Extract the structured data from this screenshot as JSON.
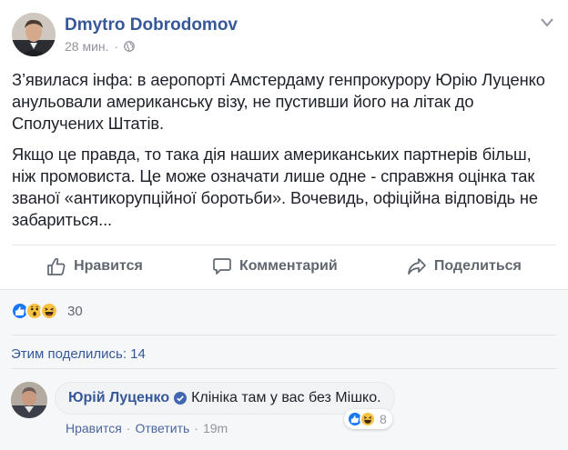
{
  "post": {
    "author": "Dmytro Dobrodomov",
    "time": "28 мин.",
    "paragraphs": [
      "З’явилася інфа: в аеропорті Амстердаму генпрокурору Юрію Луценко анульовали американську візу, не пустивши його на літак до Сполучених Штатів.",
      "Якщо це правда, то така дія наших американських партнерів більш, ніж промовиста. Це може означати лише одне - справжня оцінка так званої «антикорупційної боротьби». Вочевидь, офіційна відповідь не забариться..."
    ]
  },
  "actions": {
    "like_label": "Нравится",
    "comment_label": "Комментарий",
    "share_label": "Поделиться"
  },
  "reactions": {
    "icons": [
      "like-reaction",
      "wow-reaction",
      "haha-reaction"
    ],
    "count": "30"
  },
  "shares": {
    "text": "Этим поделились: 14"
  },
  "comment": {
    "author": "Юрій Луценко",
    "verified": true,
    "text": "Клініка там у вас без Мішко.",
    "like_label": "Нравится",
    "reply_label": "Ответить",
    "time": "19m",
    "reaction_icons": [
      "like-reaction",
      "haha-reaction"
    ],
    "reaction_count": "8"
  },
  "colors": {
    "link_blue": "#365899",
    "like_blue": "#1877f2",
    "reaction_yellow": "#f7c241",
    "muted_gray": "#90949c",
    "action_gray": "#606770"
  }
}
